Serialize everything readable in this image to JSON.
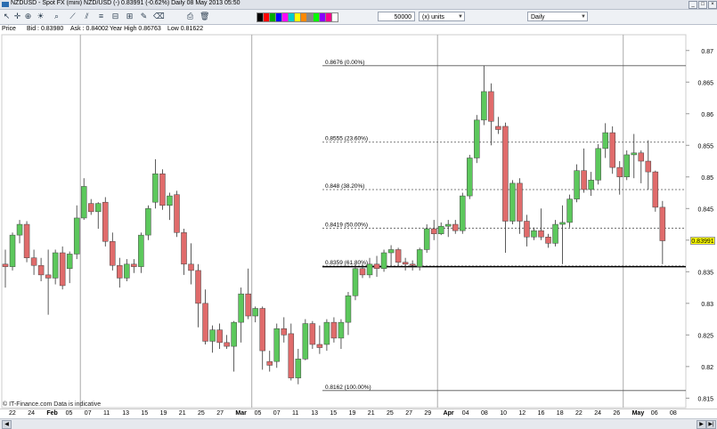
{
  "window": {
    "title": "NZDUSD - Spot FX (mini) NZD/USD (-)  0.83991 (-0.62%)  Daily 08 May 2013 05:50"
  },
  "toolbar": {
    "units_value": "50000",
    "units_label": "(x) units",
    "timeframe_value": "Daily",
    "icons": [
      "pointer-icon",
      "crosshair-icon",
      "zoom-icon",
      "lightbulb-icon",
      "search-icon",
      "trendline-icon",
      "horizontal-line-icon",
      "text-icon",
      "fibonacci-icon",
      "channel-icon",
      "pencil-icon",
      "eraser-icon",
      "print-icon",
      "delete-icon"
    ],
    "swatch_colors": [
      "#000000",
      "#ff0000",
      "#00aa00",
      "#0000ff",
      "#ff00ff",
      "#00cccc",
      "#ffff00",
      "#ff8800",
      "#888888",
      "#00ff00",
      "#8800ff",
      "#ff0088",
      "#ffffff"
    ]
  },
  "info": {
    "price_label": "Price",
    "bid": "Bid : 0.83980",
    "ask": "Ask : 0.84002",
    "year_high": "Year High 0.86763",
    "year_low": "Low 0.81622"
  },
  "chart_data": {
    "type": "candlestick",
    "instrument": "NZDUSD",
    "timeframe": "Daily",
    "current_price": "0.83991",
    "ylim": [
      0.8135,
      0.8725
    ],
    "y_ticks": [
      "0.87",
      "0.865",
      "0.86",
      "0.855",
      "0.85",
      "0.845",
      "0.84",
      "0.835",
      "0.83",
      "0.825",
      "0.82",
      "0.815"
    ],
    "x_labels": [
      "22",
      "24",
      "Feb",
      "05",
      "07",
      "11",
      "13",
      "15",
      "19",
      "21",
      "25",
      "27",
      "Mar",
      "05",
      "07",
      "11",
      "13",
      "15",
      "19",
      "21",
      "25",
      "27",
      "29",
      "Apr",
      "04",
      "08",
      "10",
      "12",
      "16",
      "18",
      "22",
      "24",
      "26",
      "May",
      "06",
      "08"
    ],
    "candles": [
      {
        "o": 0.8362,
        "h": 0.8385,
        "l": 0.8325,
        "c": 0.8358
      },
      {
        "o": 0.8358,
        "h": 0.8412,
        "l": 0.8352,
        "c": 0.8408
      },
      {
        "o": 0.8408,
        "h": 0.8432,
        "l": 0.8395,
        "c": 0.8425
      },
      {
        "o": 0.8425,
        "h": 0.843,
        "l": 0.8365,
        "c": 0.8372
      },
      {
        "o": 0.8372,
        "h": 0.8385,
        "l": 0.8345,
        "c": 0.836
      },
      {
        "o": 0.836,
        "h": 0.8372,
        "l": 0.8335,
        "c": 0.8345
      },
      {
        "o": 0.8345,
        "h": 0.8385,
        "l": 0.8282,
        "c": 0.834
      },
      {
        "o": 0.834,
        "h": 0.8385,
        "l": 0.833,
        "c": 0.838
      },
      {
        "o": 0.838,
        "h": 0.839,
        "l": 0.8322,
        "c": 0.8328
      },
      {
        "o": 0.8355,
        "h": 0.8382,
        "l": 0.8332,
        "c": 0.8378
      },
      {
        "o": 0.8378,
        "h": 0.8455,
        "l": 0.837,
        "c": 0.8435
      },
      {
        "o": 0.8435,
        "h": 0.8498,
        "l": 0.8432,
        "c": 0.8485
      },
      {
        "o": 0.8458,
        "h": 0.8465,
        "l": 0.844,
        "c": 0.8445
      },
      {
        "o": 0.8445,
        "h": 0.846,
        "l": 0.8418,
        "c": 0.8458
      },
      {
        "o": 0.846,
        "h": 0.8468,
        "l": 0.839,
        "c": 0.8398
      },
      {
        "o": 0.8398,
        "h": 0.8412,
        "l": 0.8352,
        "c": 0.836
      },
      {
        "o": 0.836,
        "h": 0.8372,
        "l": 0.8325,
        "c": 0.834
      },
      {
        "o": 0.834,
        "h": 0.837,
        "l": 0.8335,
        "c": 0.8362
      },
      {
        "o": 0.8362,
        "h": 0.837,
        "l": 0.8348,
        "c": 0.8358
      },
      {
        "o": 0.8358,
        "h": 0.8412,
        "l": 0.8348,
        "c": 0.8408
      },
      {
        "o": 0.8408,
        "h": 0.8455,
        "l": 0.84,
        "c": 0.845
      },
      {
        "o": 0.846,
        "h": 0.8528,
        "l": 0.845,
        "c": 0.8505
      },
      {
        "o": 0.8505,
        "h": 0.8512,
        "l": 0.8448,
        "c": 0.8455
      },
      {
        "o": 0.8455,
        "h": 0.8475,
        "l": 0.8432,
        "c": 0.847
      },
      {
        "o": 0.8472,
        "h": 0.8478,
        "l": 0.8405,
        "c": 0.8412
      },
      {
        "o": 0.8412,
        "h": 0.8418,
        "l": 0.8345,
        "c": 0.8362
      },
      {
        "o": 0.8362,
        "h": 0.8395,
        "l": 0.833,
        "c": 0.8352
      },
      {
        "o": 0.8352,
        "h": 0.8362,
        "l": 0.8262,
        "c": 0.83
      },
      {
        "o": 0.83,
        "h": 0.8322,
        "l": 0.8235,
        "c": 0.824
      },
      {
        "o": 0.824,
        "h": 0.8265,
        "l": 0.8222,
        "c": 0.8258
      },
      {
        "o": 0.8258,
        "h": 0.8268,
        "l": 0.8228,
        "c": 0.8238
      },
      {
        "o": 0.8238,
        "h": 0.825,
        "l": 0.8228,
        "c": 0.8232
      },
      {
        "o": 0.8232,
        "h": 0.8272,
        "l": 0.8192,
        "c": 0.827
      },
      {
        "o": 0.827,
        "h": 0.8325,
        "l": 0.8238,
        "c": 0.8315
      },
      {
        "o": 0.8315,
        "h": 0.8355,
        "l": 0.8275,
        "c": 0.828
      },
      {
        "o": 0.828,
        "h": 0.8295,
        "l": 0.827,
        "c": 0.8292
      },
      {
        "o": 0.8292,
        "h": 0.8295,
        "l": 0.8195,
        "c": 0.8225
      },
      {
        "o": 0.8208,
        "h": 0.8225,
        "l": 0.8192,
        "c": 0.8202
      },
      {
        "o": 0.8208,
        "h": 0.8268,
        "l": 0.8198,
        "c": 0.826
      },
      {
        "o": 0.826,
        "h": 0.8278,
        "l": 0.8238,
        "c": 0.825
      },
      {
        "o": 0.8252,
        "h": 0.8268,
        "l": 0.8178,
        "c": 0.8182
      },
      {
        "o": 0.8182,
        "h": 0.8228,
        "l": 0.8172,
        "c": 0.8212
      },
      {
        "o": 0.8212,
        "h": 0.8275,
        "l": 0.821,
        "c": 0.8268
      },
      {
        "o": 0.8268,
        "h": 0.8272,
        "l": 0.8228,
        "c": 0.8235
      },
      {
        "o": 0.8235,
        "h": 0.8265,
        "l": 0.822,
        "c": 0.823
      },
      {
        "o": 0.8235,
        "h": 0.8275,
        "l": 0.8225,
        "c": 0.827
      },
      {
        "o": 0.827,
        "h": 0.8278,
        "l": 0.8238,
        "c": 0.8245
      },
      {
        "o": 0.8245,
        "h": 0.8275,
        "l": 0.8228,
        "c": 0.827
      },
      {
        "o": 0.827,
        "h": 0.8318,
        "l": 0.825,
        "c": 0.8312
      },
      {
        "o": 0.8312,
        "h": 0.8362,
        "l": 0.8305,
        "c": 0.8355
      },
      {
        "o": 0.8355,
        "h": 0.8362,
        "l": 0.834,
        "c": 0.8345
      },
      {
        "o": 0.8345,
        "h": 0.8372,
        "l": 0.834,
        "c": 0.8362
      },
      {
        "o": 0.8362,
        "h": 0.8375,
        "l": 0.8342,
        "c": 0.8355
      },
      {
        "o": 0.8355,
        "h": 0.8385,
        "l": 0.835,
        "c": 0.838
      },
      {
        "o": 0.838,
        "h": 0.8392,
        "l": 0.8358,
        "c": 0.8385
      },
      {
        "o": 0.8385,
        "h": 0.8388,
        "l": 0.8358,
        "c": 0.8365
      },
      {
        "o": 0.8365,
        "h": 0.8372,
        "l": 0.8352,
        "c": 0.8362
      },
      {
        "o": 0.8362,
        "h": 0.8368,
        "l": 0.8352,
        "c": 0.836
      },
      {
        "o": 0.8358,
        "h": 0.8388,
        "l": 0.8352,
        "c": 0.8385
      },
      {
        "o": 0.8385,
        "h": 0.8425,
        "l": 0.838,
        "c": 0.8418
      },
      {
        "o": 0.8418,
        "h": 0.8432,
        "l": 0.84,
        "c": 0.841
      },
      {
        "o": 0.841,
        "h": 0.8428,
        "l": 0.8408,
        "c": 0.8422
      },
      {
        "o": 0.8422,
        "h": 0.8432,
        "l": 0.8405,
        "c": 0.8425
      },
      {
        "o": 0.8425,
        "h": 0.8432,
        "l": 0.841,
        "c": 0.8415
      },
      {
        "o": 0.8415,
        "h": 0.8475,
        "l": 0.841,
        "c": 0.847
      },
      {
        "o": 0.847,
        "h": 0.8535,
        "l": 0.8465,
        "c": 0.853
      },
      {
        "o": 0.853,
        "h": 0.8598,
        "l": 0.8522,
        "c": 0.859
      },
      {
        "o": 0.859,
        "h": 0.8676,
        "l": 0.8582,
        "c": 0.8635
      },
      {
        "o": 0.8635,
        "h": 0.8648,
        "l": 0.855,
        "c": 0.8588
      },
      {
        "o": 0.858,
        "h": 0.8595,
        "l": 0.8568,
        "c": 0.8575
      },
      {
        "o": 0.858,
        "h": 0.8586,
        "l": 0.838,
        "c": 0.843
      },
      {
        "o": 0.843,
        "h": 0.8495,
        "l": 0.8425,
        "c": 0.849
      },
      {
        "o": 0.849,
        "h": 0.8498,
        "l": 0.841,
        "c": 0.843
      },
      {
        "o": 0.843,
        "h": 0.844,
        "l": 0.839,
        "c": 0.8405
      },
      {
        "o": 0.8405,
        "h": 0.842,
        "l": 0.84,
        "c": 0.8415
      },
      {
        "o": 0.8415,
        "h": 0.845,
        "l": 0.84,
        "c": 0.8405
      },
      {
        "o": 0.8405,
        "h": 0.841,
        "l": 0.8388,
        "c": 0.8395
      },
      {
        "o": 0.8395,
        "h": 0.8432,
        "l": 0.839,
        "c": 0.8425
      },
      {
        "o": 0.8425,
        "h": 0.8455,
        "l": 0.8362,
        "c": 0.8428
      },
      {
        "o": 0.8428,
        "h": 0.8472,
        "l": 0.842,
        "c": 0.8465
      },
      {
        "o": 0.8465,
        "h": 0.852,
        "l": 0.846,
        "c": 0.851
      },
      {
        "o": 0.851,
        "h": 0.8545,
        "l": 0.8475,
        "c": 0.848
      },
      {
        "o": 0.848,
        "h": 0.8508,
        "l": 0.847,
        "c": 0.8495
      },
      {
        "o": 0.8495,
        "h": 0.8552,
        "l": 0.8488,
        "c": 0.8545
      },
      {
        "o": 0.8545,
        "h": 0.8585,
        "l": 0.853,
        "c": 0.857
      },
      {
        "o": 0.857,
        "h": 0.858,
        "l": 0.8505,
        "c": 0.8515
      },
      {
        "o": 0.8515,
        "h": 0.8525,
        "l": 0.8472,
        "c": 0.85
      },
      {
        "o": 0.85,
        "h": 0.8542,
        "l": 0.8495,
        "c": 0.8535
      },
      {
        "o": 0.8535,
        "h": 0.8568,
        "l": 0.8498,
        "c": 0.8538
      },
      {
        "o": 0.8538,
        "h": 0.8542,
        "l": 0.849,
        "c": 0.8525
      },
      {
        "o": 0.8525,
        "h": 0.8558,
        "l": 0.848,
        "c": 0.8508
      },
      {
        "o": 0.8508,
        "h": 0.851,
        "l": 0.8445,
        "c": 0.8452
      },
      {
        "o": 0.8452,
        "h": 0.8462,
        "l": 0.8362,
        "c": 0.8399
      }
    ],
    "fib_levels": [
      {
        "pct": "0.00%",
        "price": 0.8676,
        "label": "0.8676 (0.00%)"
      },
      {
        "pct": "23.60%",
        "price": 0.8555,
        "label": "0.8555 (23.60%)"
      },
      {
        "pct": "38.20%",
        "price": 0.848,
        "label": "0.848 (38.20%)"
      },
      {
        "pct": "50.00%",
        "price": 0.8419,
        "label": "0.8419 (50.00%)"
      },
      {
        "pct": "61.80%",
        "price": 0.8359,
        "label": "0.8359 (61.80%)"
      },
      {
        "pct": "100.00%",
        "price": 0.8162,
        "label": "0.8162 (100.00%)"
      }
    ],
    "support_line": 0.8358,
    "up_color": "#5cc85c",
    "down_color": "#e06b6b",
    "grid": true
  },
  "footer": {
    "watermark": "© IT-Finance.com  Data is indicative"
  }
}
